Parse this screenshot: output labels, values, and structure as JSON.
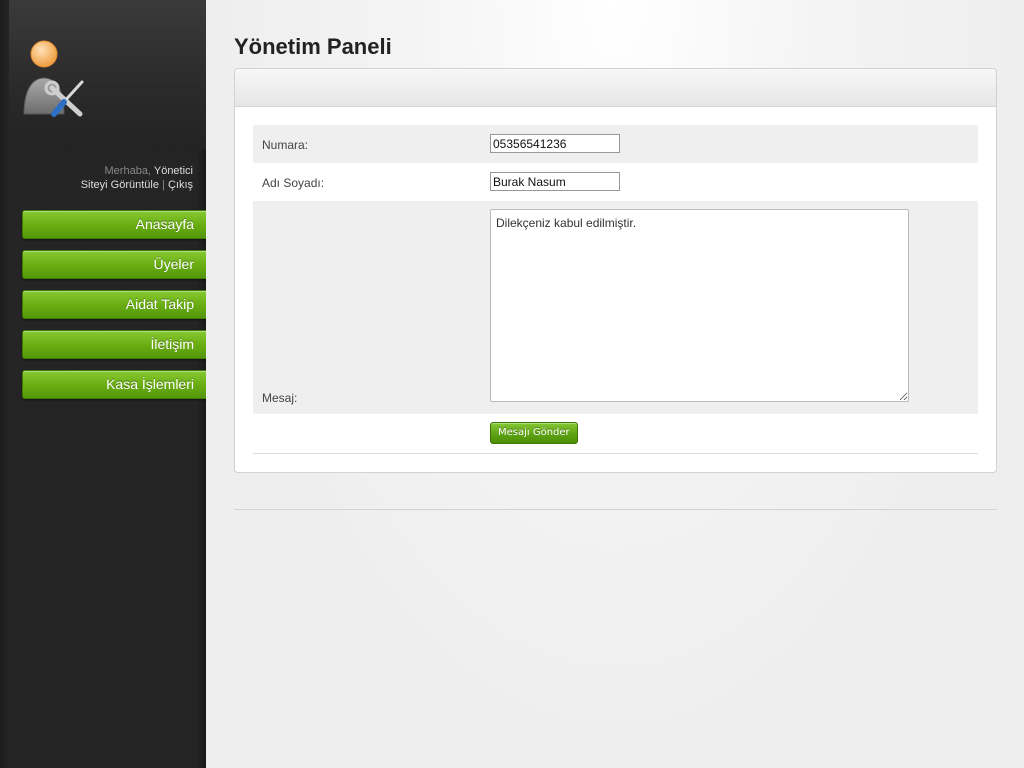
{
  "sidebar": {
    "greeting_prefix": "Merhaba,",
    "user_name": "Yönetici",
    "view_site": "Siteyi Görüntüle",
    "separator": "|",
    "logout": "Çıkış",
    "nav": [
      {
        "label": "Anasayfa"
      },
      {
        "label": "Üyeler"
      },
      {
        "label": "Aidat Takip"
      },
      {
        "label": "İletişim"
      },
      {
        "label": "Kasa İşlemleri"
      }
    ],
    "avatar_icon": "admin-user-tools-icon"
  },
  "main": {
    "title": "Yönetim Paneli",
    "form": {
      "number_label": "Numara:",
      "number_value": "05356541236",
      "name_label": "Adı Soyadı:",
      "name_value": "Burak Nasum",
      "message_label": "Mesaj:",
      "message_value": "Dilekçeniz kabul edilmiştir.",
      "submit_label": "Mesajı Gönder"
    }
  },
  "colors": {
    "accent_green": "#6aae12",
    "sidebar_dark": "#242424"
  }
}
